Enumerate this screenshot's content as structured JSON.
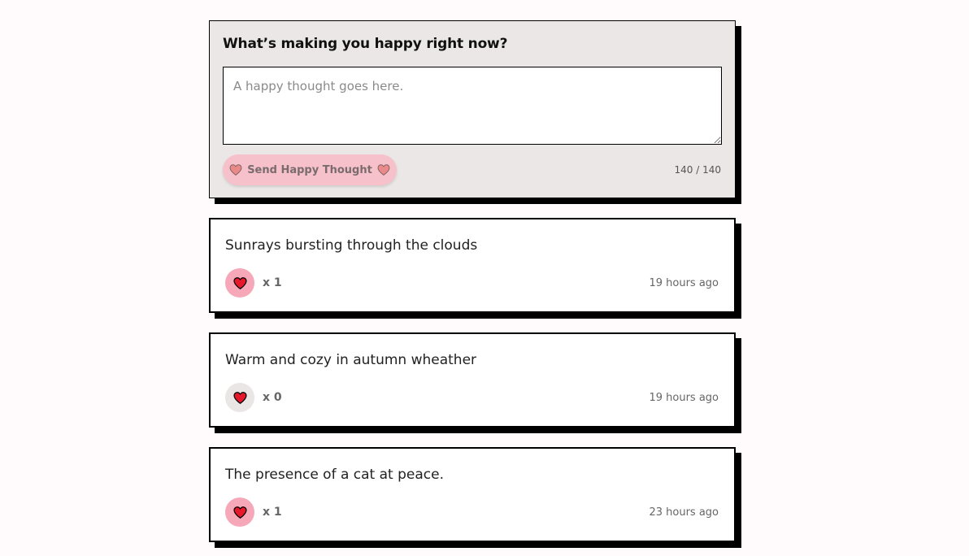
{
  "form": {
    "title": "What’s making you happy right now?",
    "input_placeholder": "A happy thought goes here.",
    "input_value": "",
    "send_label": "Send Happy Thought",
    "char_count": "140 / 140",
    "heart_icon": "heart-icon"
  },
  "colors": {
    "background": "#fffafb",
    "form_background": "#ebe7e6",
    "send_button": "#f6c1cb",
    "liked_button": "#f7a8b8",
    "unliked_button": "#eae6e5",
    "heart_fill": "#e8182c",
    "shadow": "#000000"
  },
  "thoughts": [
    {
      "message": "Sunrays bursting through the clouds",
      "likes": "x 1",
      "liked": true,
      "time": "19 hours ago"
    },
    {
      "message": "Warm and cozy in autumn wheather",
      "likes": "x 0",
      "liked": false,
      "time": "19 hours ago"
    },
    {
      "message": "The presence of a cat at peace.",
      "likes": "x 1",
      "liked": true,
      "time": "23 hours ago"
    }
  ]
}
